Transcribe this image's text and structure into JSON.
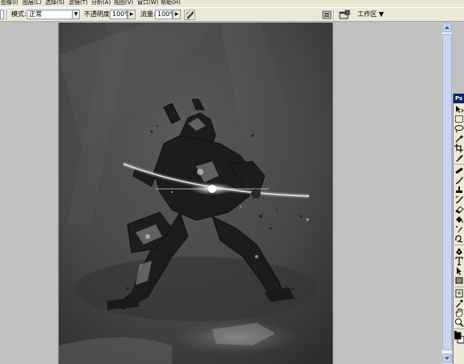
{
  "menubar": {
    "items": [
      "图像(I)",
      "图层(L)",
      "选择(S)",
      "滤镜(T)",
      "分析(A)",
      "视图(V)",
      "窗口(W)",
      "帮助(H)"
    ]
  },
  "options": {
    "mode_label": "模式:",
    "mode_value": "正常",
    "opacity_label": "不透明度:",
    "opacity_value": "100%",
    "flow_label": "流量:",
    "flow_value": "100%",
    "workspace_label": "工作区 ▼"
  },
  "toolbox": {
    "title": "Ps",
    "tools": [
      "move-tool",
      "marquee-tool",
      "lasso-tool",
      "magic-wand-tool",
      "crop-tool",
      "slice-tool",
      "healing-brush-tool",
      "brush-tool",
      "clone-stamp-tool",
      "history-brush-tool",
      "eraser-tool",
      "gradient-tool",
      "blur-tool",
      "dodge-tool",
      "pen-tool",
      "type-tool",
      "path-selection-tool",
      "shape-tool",
      "notes-tool",
      "eyedropper-tool",
      "hand-tool",
      "zoom-tool",
      "color-swatches"
    ]
  },
  "icons": {
    "airbrush": "airbrush-icon",
    "palette_well": "palette-well-icon",
    "scroll_up": "scroll-up-icon",
    "scroll_down": "scroll-down-icon"
  },
  "colors": {
    "ui_bg": "#ece9d8",
    "doc_bg": "#c0c0c0",
    "canvas_bg": "#4a4a4a",
    "title_blue": "#0a246a"
  }
}
